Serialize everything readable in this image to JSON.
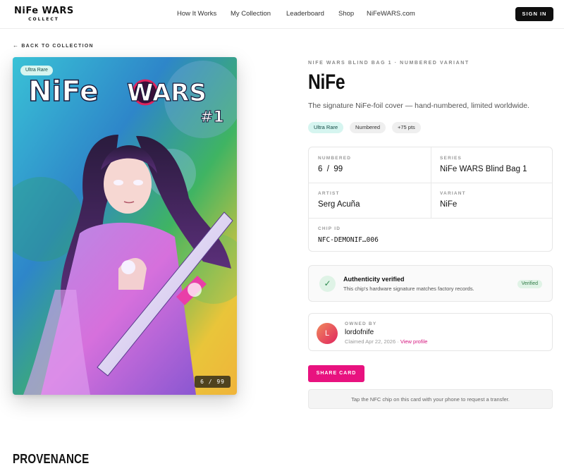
{
  "header": {
    "logo_text": "NiFe WARS",
    "logo_sub": "COLLECT",
    "nav": [
      "How It Works",
      "My Collection",
      "Leaderboard",
      "Shop",
      "NiFeWARS.com"
    ],
    "signin_label": "SIGN IN"
  },
  "back_link": "BACK TO COLLECTION",
  "card": {
    "rarity": "Ultra Rare",
    "cover_title": "NiFe WARS",
    "issue": "#1",
    "number_display": "6 / 99",
    "palette": {
      "teal": "#2cc6c9",
      "blue": "#2a6fd6",
      "green": "#46b95a",
      "yellow": "#f2c83a",
      "magenta": "#d14bd8"
    }
  },
  "product": {
    "kicker": "NIFE WARS BLIND BAG 1 · NUMBERED VARIANT",
    "title": "NiFe",
    "subtitle": "The signature NiFe-foil cover — hand-numbered, limited worldwide.",
    "tags": [
      "Ultra Rare",
      "Numbered",
      "+75 pts"
    ]
  },
  "specs": {
    "numbered_label": "NUMBERED",
    "numbered_value": "6  /  99",
    "series_label": "SERIES",
    "series_value": "NiFe WARS Blind Bag 1",
    "artist_label": "ARTIST",
    "artist_value": "Serg Acuña",
    "variant_label": "VARIANT",
    "variant_value": "NiFe",
    "chip_label": "CHIP ID",
    "chip_value": "NFC-DEMONIF…006"
  },
  "authenticity": {
    "title": "Authenticity verified",
    "description": "This chip's hardware signature matches factory records.",
    "badge": "Verified"
  },
  "owner": {
    "label": "OWNED BY",
    "initial": "L",
    "name": "lordofnife",
    "claimed": "Claimed Apr 22, 2026 ·",
    "profile_link": "View profile"
  },
  "actions": {
    "share_label": "SHARE CARD",
    "nfc_note": "Tap the NFC chip on this card with your phone to request a transfer."
  },
  "provenance_heading": "PROVENANCE",
  "colors": {
    "accent": "#e8127f",
    "verified": "#2f8a4f",
    "rare_pill": "#d6f5f0"
  }
}
